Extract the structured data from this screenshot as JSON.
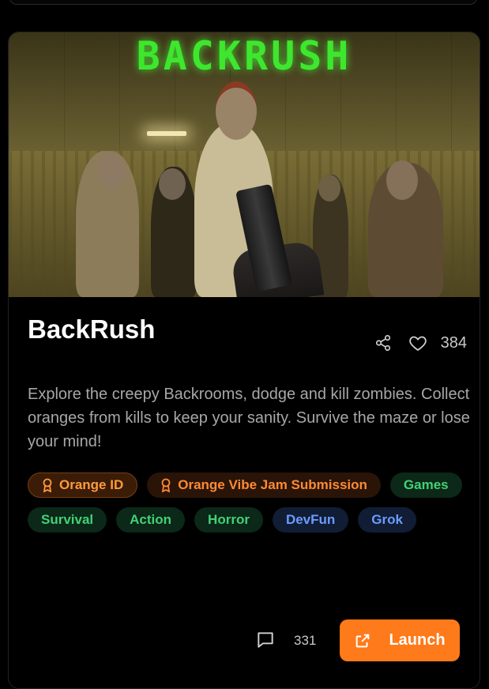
{
  "game": {
    "logo_text": "BACKRUSH",
    "title": "BackRush",
    "likes": "384",
    "description": "Explore the creepy Backrooms, dodge and kill zombies. Collect oranges from kills to keep your sanity. Survive the maze or lose your mind!",
    "comments": "331",
    "launch_label": "Launch"
  },
  "tags": [
    {
      "label": "Orange ID",
      "style": "orange",
      "icon": "badge-icon"
    },
    {
      "label": "Orange Vibe Jam Submission",
      "style": "orange-plain",
      "icon": "badge-icon"
    },
    {
      "label": "Games",
      "style": "green"
    },
    {
      "label": "Survival",
      "style": "green"
    },
    {
      "label": "Action",
      "style": "green"
    },
    {
      "label": "Horror",
      "style": "green"
    },
    {
      "label": "DevFun",
      "style": "blue"
    },
    {
      "label": "Grok",
      "style": "blue"
    }
  ],
  "icons": {
    "share": "share-icon",
    "like": "heart-icon",
    "comment": "comment-icon",
    "launch": "external-link-icon"
  },
  "colors": {
    "accent": "#ff7a1a",
    "logo_green": "#3fe62e",
    "tag_green": "#43d176",
    "tag_blue": "#6c9cff",
    "tag_orange": "#ff9b3d"
  }
}
